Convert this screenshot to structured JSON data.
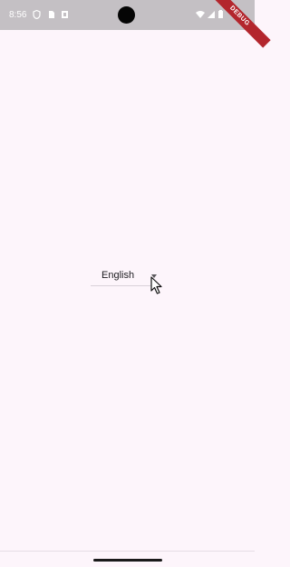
{
  "status_bar": {
    "time": "8:56",
    "left_icons": [
      "shield-icon",
      "sim-card-icon",
      "notification-box-icon"
    ],
    "right_icons": [
      "wifi-icon",
      "signal-icon",
      "battery-icon"
    ]
  },
  "debug_banner": {
    "label": "DEBUG"
  },
  "language_dropdown": {
    "selected": "English",
    "icon": "dropdown-arrow-icon"
  },
  "colors": {
    "background": "#fdf5fb",
    "status_bar": "#c4c0c4",
    "debug_banner": "#b3262d",
    "text": "#1c1b1f"
  }
}
